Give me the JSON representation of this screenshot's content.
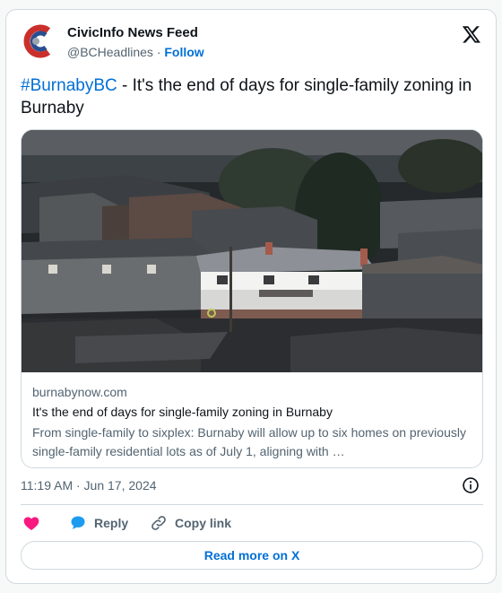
{
  "author": {
    "display_name": "CivicInfo News Feed",
    "handle": "@BCHeadlines",
    "separator": "·",
    "follow_label": "Follow"
  },
  "tweet": {
    "hashtag": "#BurnabyBC",
    "text": " - It's the end of days for single-family zoning in Burnaby"
  },
  "link_card": {
    "domain": "burnabynow.com",
    "title": "It's the end of days for single-family zoning in Burnaby",
    "description": "From single-family to sixplex: Burnaby will allow up to six homes on previously single-family residential lots as of July 1, aligning with …"
  },
  "timestamp": "11:19 AM · Jun 17, 2024",
  "actions": {
    "like_label": "",
    "reply_label": "Reply",
    "copy_label": "Copy link"
  },
  "read_more_label": "Read more on X",
  "colors": {
    "link": "#006fd6",
    "like": "#f91880",
    "reply": "#1d9bf0",
    "text_secondary": "#536471",
    "border": "#cfd9de"
  },
  "icons": [
    "x-logo-icon",
    "info-icon",
    "heart-icon",
    "speech-bubble-icon",
    "link-icon"
  ]
}
